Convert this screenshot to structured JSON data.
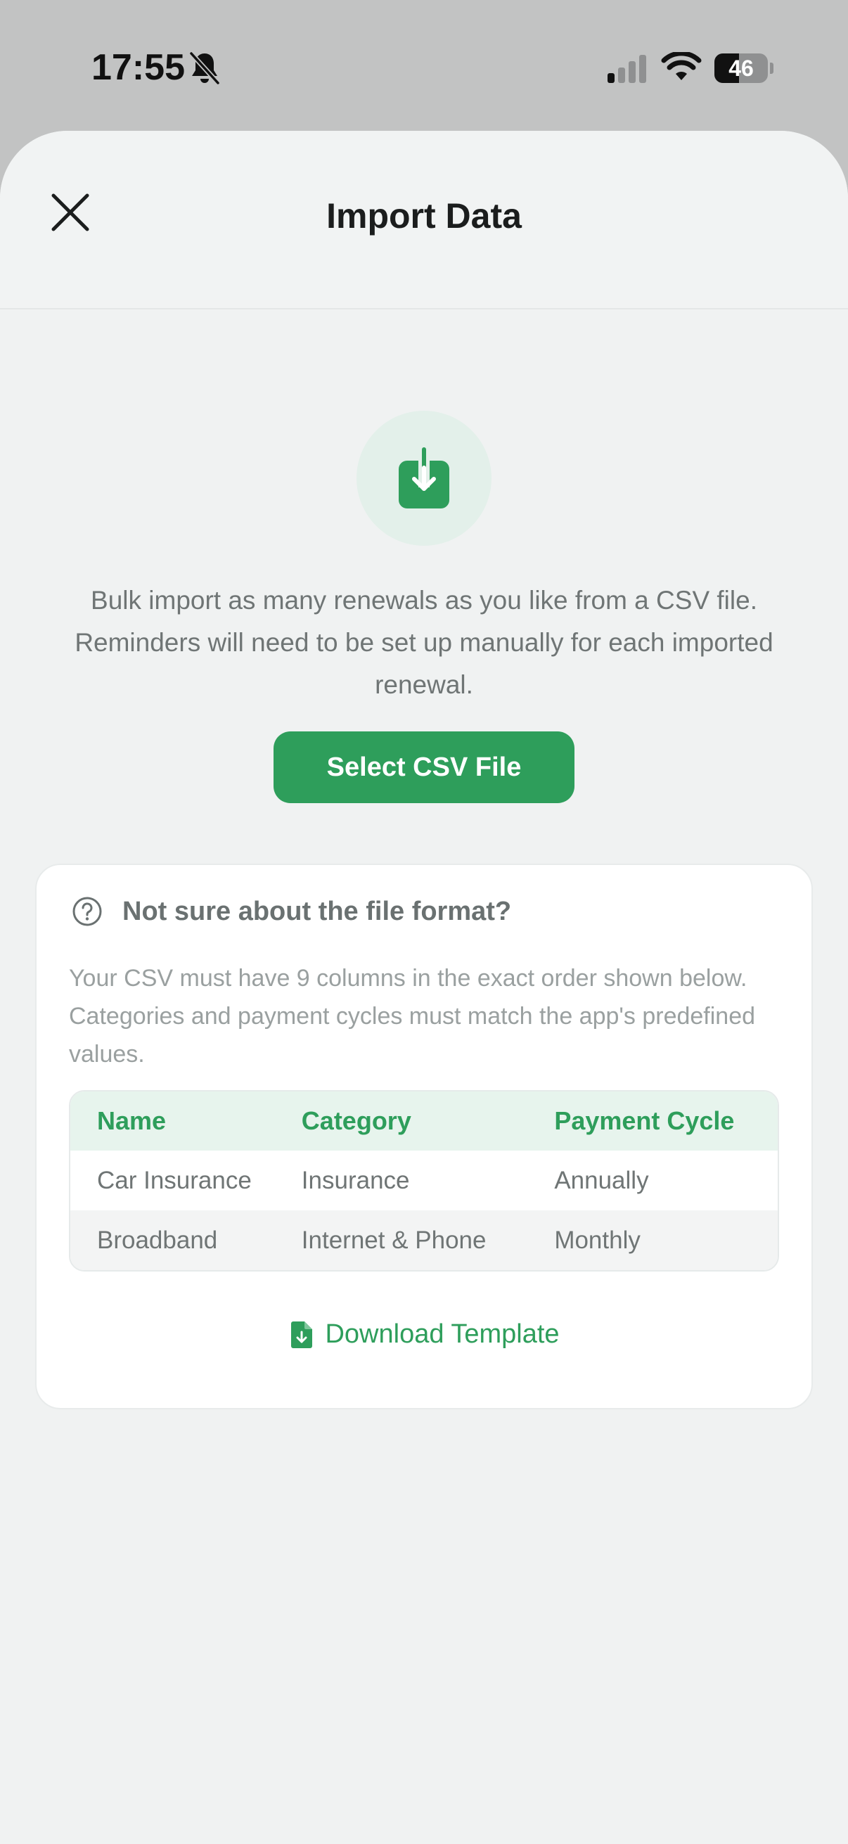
{
  "status_bar": {
    "time": "17:55",
    "battery": "46",
    "battery_level_percent": 46,
    "icons": [
      "bell-slash-icon",
      "signal-icon",
      "wifi-icon",
      "battery-icon"
    ]
  },
  "header": {
    "title": "Import Data",
    "close_icon": "close-icon"
  },
  "main": {
    "import_icon": "download-tray-icon",
    "intro_text": "Bulk import as many renewals as you like from a CSV file. Reminders will need to be set up manually for each imported renewal.",
    "select_button_label": "Select CSV File"
  },
  "help_card": {
    "icon": "question-circle-icon",
    "title": "Not sure about the file format?",
    "description": "Your CSV must have 9 columns in the exact order shown below. Categories and payment cycles must match the app's predefined values.",
    "table": {
      "headers": [
        "Name",
        "Category",
        "Payment Cycle"
      ],
      "rows": [
        [
          "Car Insurance",
          "Insurance",
          "Annually"
        ],
        [
          "Broadband",
          "Internet & Phone",
          "Monthly"
        ]
      ]
    },
    "download_label": "Download Template",
    "download_icon": "document-download-icon"
  },
  "colors": {
    "accent": "#2e9e5b",
    "accent_light": "#e3f0ea",
    "background": "#f0f2f2",
    "text_muted": "#6f7575"
  }
}
